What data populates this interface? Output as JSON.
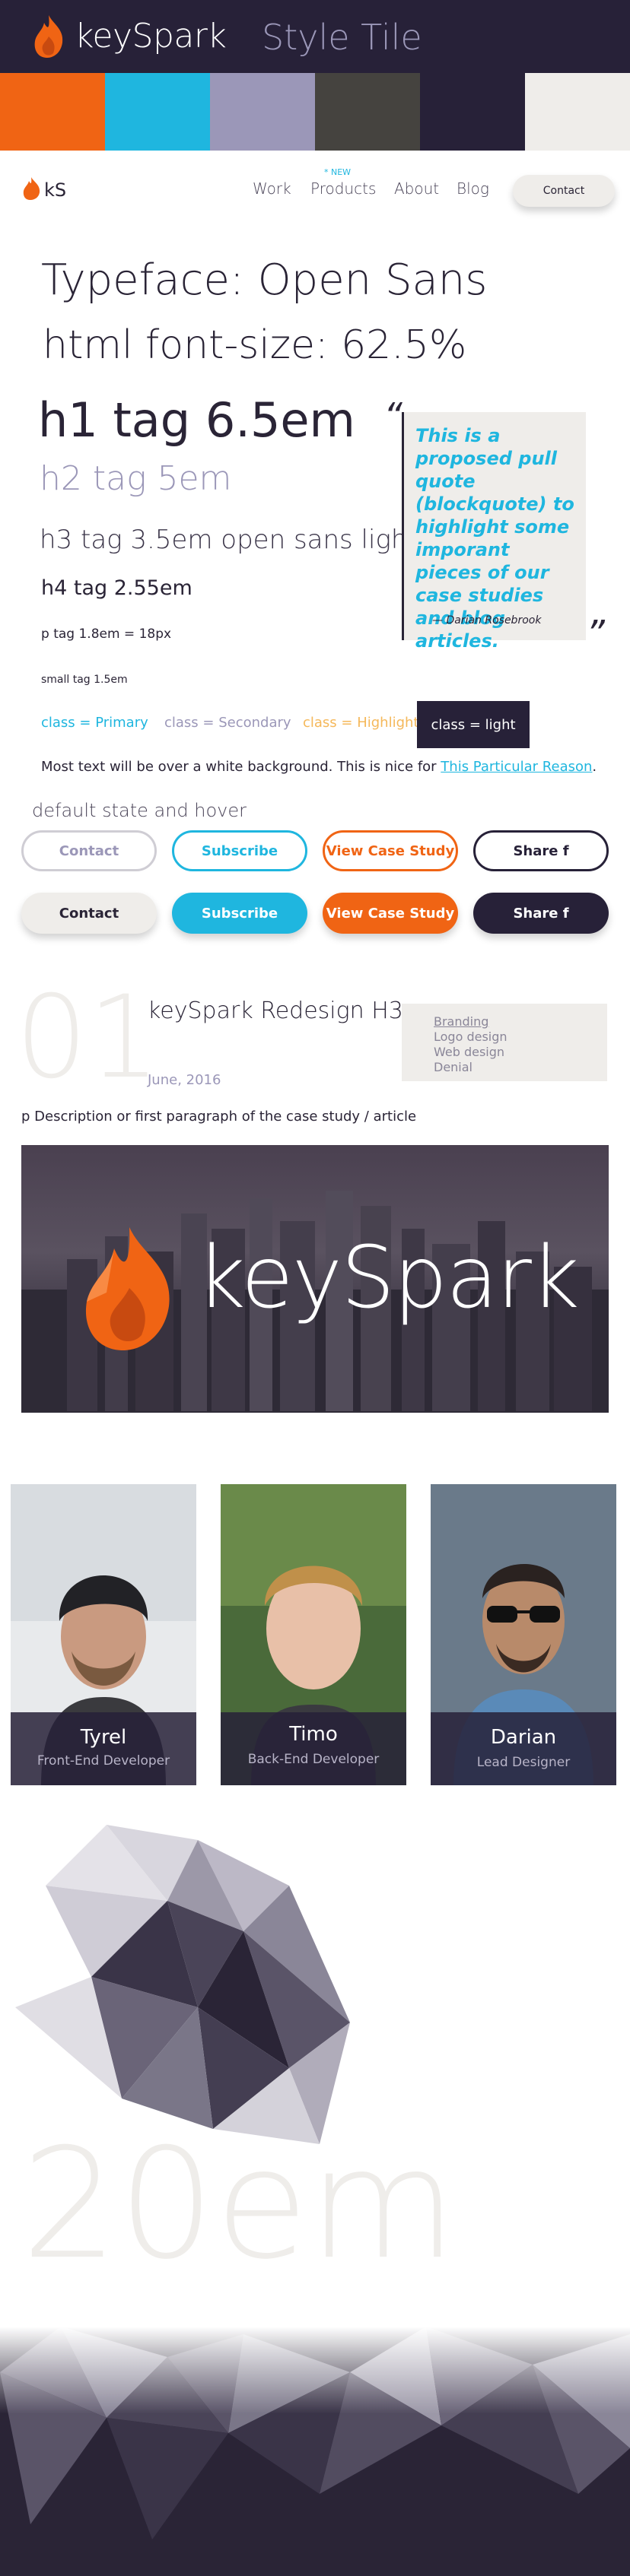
{
  "header": {
    "brand": "keySpark",
    "title": "Style Tile"
  },
  "colors": {
    "swatches": [
      "#f06414",
      "#1fb6df",
      "#9b97b8",
      "#45433f",
      "#272138",
      "#efedea"
    ],
    "primary": "#1fb6df",
    "secondary": "#9b97b8",
    "highlight": "#f5b85a",
    "dark": "#272138",
    "orange": "#f06414"
  },
  "nav": {
    "logo_text": "kS",
    "items": [
      "Work",
      "Products",
      "About",
      "Blog"
    ],
    "new_badge": "* NEW",
    "contact": "Contact"
  },
  "typography": {
    "typeface": "Typeface: Open Sans",
    "html_fs": "html font-size: 62.5%",
    "h1": "h1 tag 6.5em",
    "h2": "h2 tag 5em",
    "h3": "h3 tag 3.5em open sans light",
    "h4": "h4 tag 2.55em",
    "p": "p tag 1.8em =  18px",
    "small": "small tag 1.5em"
  },
  "blockquote": {
    "text": "This is a proposed pull quote (blockquote) to highlight some imporant pieces of our case studies and blog articles.",
    "cite": "— Darian Rosebrook"
  },
  "classes": {
    "primary": "class = Primary",
    "secondary": "class = Secondary",
    "highlight": "class = Highlight",
    "light": "class = light"
  },
  "most_text": {
    "before": "Most text will be over a white background. This is nice for ",
    "link": "This Particular Reason",
    "after": "."
  },
  "buttons": {
    "section_label": "default state and hover",
    "contact": "Contact",
    "subscribe": "Subscribe",
    "view_case": "View Case Study",
    "share": "Share f"
  },
  "article": {
    "number": "01",
    "title": "keySpark Redesign H3",
    "date": "June, 2016",
    "tags": [
      "Branding",
      "Logo design",
      "Web design",
      "Denial"
    ],
    "description": "p Description or first paragraph of the case study / article",
    "hero_text": "keySpark"
  },
  "team": [
    {
      "name": "Tyrel",
      "role": "Front-End Developer"
    },
    {
      "name": "Timo",
      "role": "Back-End Developer"
    },
    {
      "name": "Darian",
      "role": "Lead Designer"
    }
  ],
  "big_text": "20em"
}
